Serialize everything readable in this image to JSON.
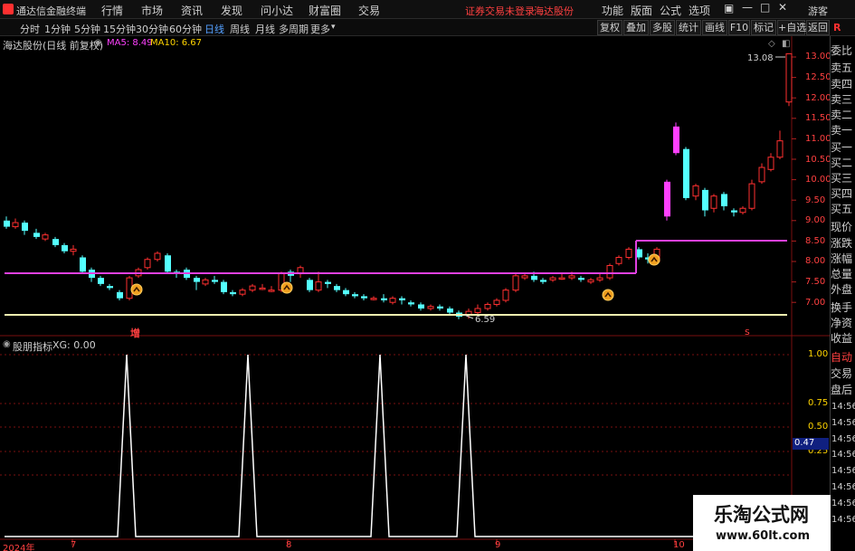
{
  "topbar": {
    "app_title": "通达信金融终端",
    "menu": [
      "行情",
      "市场",
      "资讯",
      "发现",
      "问小达",
      "财富圈",
      "交易"
    ],
    "status_text": "证券交易未登录",
    "stock_name": "海达股份",
    "right_menu": [
      "功能",
      "版面",
      "公式",
      "选项"
    ],
    "guest": "游客"
  },
  "periodbar": {
    "periods": [
      "分时",
      "1分钟",
      "5分钟",
      "15分钟",
      "30分钟",
      "60分钟",
      "日线",
      "周线",
      "月线",
      "多周期",
      "更多"
    ],
    "tools": [
      "复权",
      "叠加",
      "多股",
      "统计",
      "画线",
      "F10",
      "标记",
      "+自选",
      "返回"
    ]
  },
  "main_panel": {
    "title": "海达股份(日线 前复权)",
    "ma5_label": "MA5: 8.49",
    "ma10_label": "MA10: 6.67",
    "max_label": "13.08",
    "min_label": "6.59",
    "marker_zeng": "增",
    "marker_s": "s",
    "y_ticks": [
      "13.00",
      "12.50",
      "12.00",
      "11.50",
      "11.00",
      "10.50",
      "10.00",
      "9.50",
      "9.00",
      "8.50",
      "8.00",
      "7.50",
      "7.00"
    ]
  },
  "sub_panel": {
    "title": "股朋指标",
    "xg_label": "XG: 0.00",
    "y_ticks": [
      "1.00",
      "0.75",
      "0.50",
      "0.25"
    ],
    "cursor_value": "0.47"
  },
  "x_axis": [
    "2024年",
    "7",
    "8",
    "9",
    "10"
  ],
  "right_panel": {
    "quote_labels": [
      "委比",
      "卖五",
      "卖四",
      "卖三",
      "卖二",
      "卖一",
      "买一",
      "买二",
      "买三",
      "买四",
      "买五",
      "现价",
      "涨跌",
      "涨幅",
      "总量",
      "外盘",
      "换手",
      "净资",
      "收益"
    ],
    "trade_labels": [
      "自动",
      "交易",
      "盘后"
    ],
    "times": [
      "14:56",
      "14:56",
      "14:56",
      "14:56",
      "14:56",
      "14:56",
      "14:56",
      "14:56"
    ]
  },
  "watermark": {
    "title": "乐淘公式网",
    "url": "www.60lt.com"
  },
  "colors": {
    "up": "#ff3030",
    "down": "#54ffff",
    "ma_line": "#e040e0",
    "support": "#f0f0b0",
    "label_red": "#ff4040",
    "magenta_candle": "#ff40ff"
  }
}
